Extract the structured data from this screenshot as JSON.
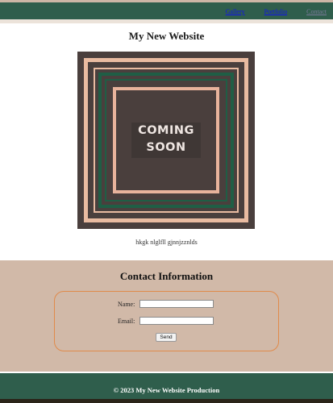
{
  "nav": {
    "items": [
      {
        "label": "Gallery"
      },
      {
        "label": "Portfolio"
      },
      {
        "label": "Contact"
      }
    ]
  },
  "header": {
    "title": "My New Website"
  },
  "hero": {
    "line1": "COMING",
    "line2": "SOON",
    "caption": "hkgk nlglfll gjnnjzznlds"
  },
  "contact": {
    "title": "Contact Information",
    "name_label": "Name:",
    "name_value": "",
    "email_label": "Email:",
    "email_value": "",
    "send_label": "Send"
  },
  "footer": {
    "text": "© 2023 My New Website Production"
  },
  "colors": {
    "nav_bg": "#2f5e4c",
    "contact_bg": "#d1b9a8",
    "form_border": "#e08a4a",
    "hero_bg": "#4a3f3d"
  }
}
